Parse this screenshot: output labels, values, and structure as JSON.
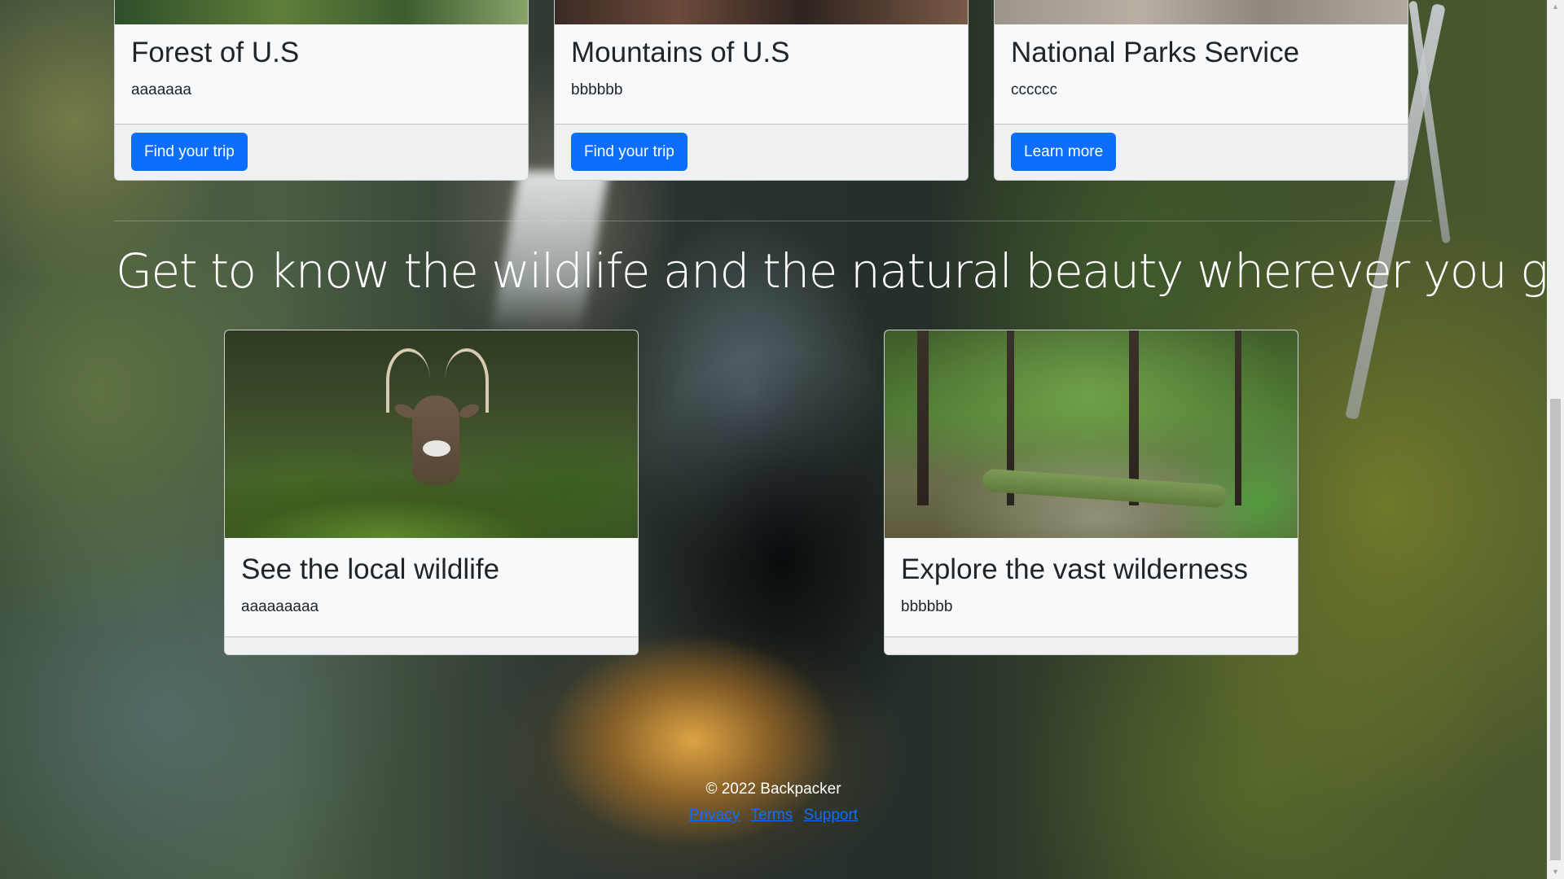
{
  "top_cards": [
    {
      "title": "Forest of U.S",
      "text": "aaaaaaa",
      "button": "Find your trip"
    },
    {
      "title": "Mountains of U.S",
      "text": "bbbbbb",
      "button": "Find your trip"
    },
    {
      "title": "National Parks Service",
      "text": "cccccc",
      "button": "Learn more"
    }
  ],
  "section_heading": "Get to know the wildlife and the natural beauty wherever you go",
  "bottom_cards": [
    {
      "title": "See the local wildlife",
      "text": "aaaaaaaaa",
      "image": "deer-photo"
    },
    {
      "title": "Explore the vast wilderness",
      "text": "bbbbbb",
      "image": "forest-photo"
    }
  ],
  "footer": {
    "copyright": "© 2022 Backpacker",
    "links": [
      "Privacy",
      "Terms",
      "Support"
    ]
  },
  "colors": {
    "primary_button": "#0d6efd",
    "link": "#0d6efd",
    "card_background": "#f8f9fa",
    "heading_text": "#ffffff"
  }
}
